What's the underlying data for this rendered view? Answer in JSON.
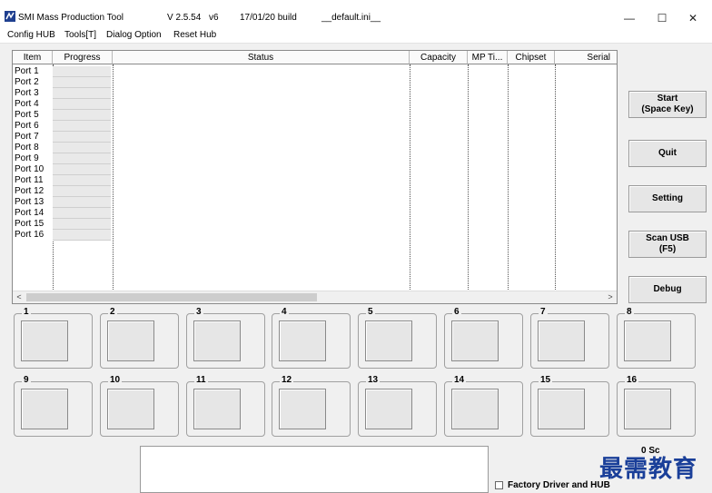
{
  "titlebar": {
    "app_name": "SMI Mass Production Tool",
    "version": "V 2.5.54",
    "variant": "v6",
    "build": "17/01/20 build",
    "ini_file": "__default.ini__",
    "minimize": "—",
    "maximize": "☐",
    "close": "✕"
  },
  "menu": {
    "config_hub": "Config HUB",
    "tools": "Tools[T]",
    "dialog_option": "Dialog Option",
    "reset_hub": "Reset Hub"
  },
  "grid": {
    "columns": [
      "Item",
      "Progress",
      "Status",
      "Capacity",
      "MP Ti...",
      "Chipset",
      "Serial"
    ],
    "ports": [
      "Port 1",
      "Port 2",
      "Port 3",
      "Port 4",
      "Port 5",
      "Port 6",
      "Port 7",
      "Port 8",
      "Port 9",
      "Port 10",
      "Port 11",
      "Port 12",
      "Port 13",
      "Port 14",
      "Port 15",
      "Port 16"
    ],
    "scroll_left": "<",
    "scroll_right": ">"
  },
  "buttons": {
    "start": "Start\n(Space Key)",
    "quit": "Quit",
    "setting": "Setting",
    "scan_usb": "Scan USB\n(F5)",
    "debug": "Debug"
  },
  "port_boxes": [
    "1",
    "2",
    "3",
    "4",
    "5",
    "6",
    "7",
    "8",
    "9",
    "10",
    "11",
    "12",
    "13",
    "14",
    "15",
    "16"
  ],
  "footer": {
    "factory_driver": "Factory Driver and HUB",
    "corner_text": "0 Sc",
    "watermark": "最需教育"
  }
}
